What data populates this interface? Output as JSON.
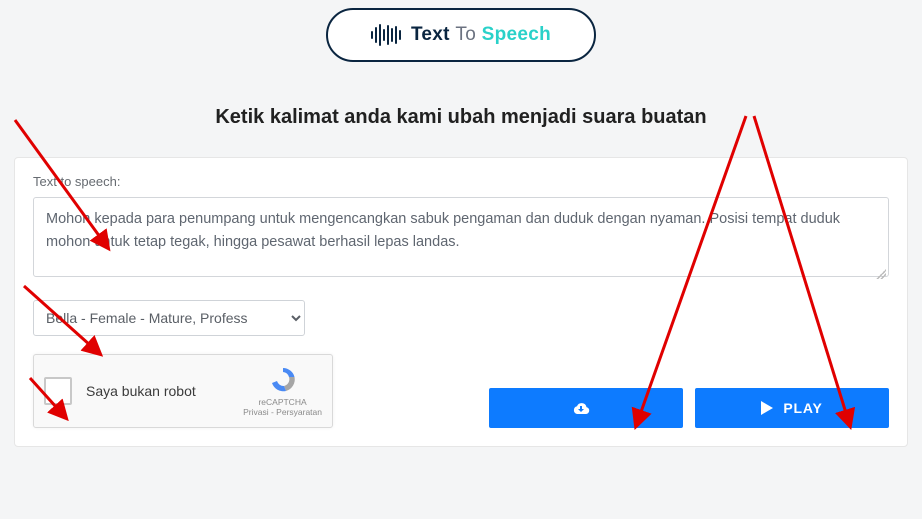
{
  "logo": {
    "word1": "Text",
    "word2": "To",
    "word3": "Speech"
  },
  "headline": "Ketik kalimat anda kami ubah menjadi suara buatan",
  "form": {
    "textarea_label": "Text to speech:",
    "textarea_value": "Mohon kepada para penumpang untuk mengencangkan sabuk pengaman dan duduk dengan nyaman. Posisi tempat duduk mohon untuk tetap tegak, hingga pesawat berhasil lepas landas.",
    "voice_selected": "Bella - Female - Mature, Profess"
  },
  "captcha": {
    "label": "Saya bukan robot",
    "brand": "reCAPTCHA",
    "links": "Privasi - Persyaratan"
  },
  "buttons": {
    "download": "",
    "play": "PLAY"
  }
}
